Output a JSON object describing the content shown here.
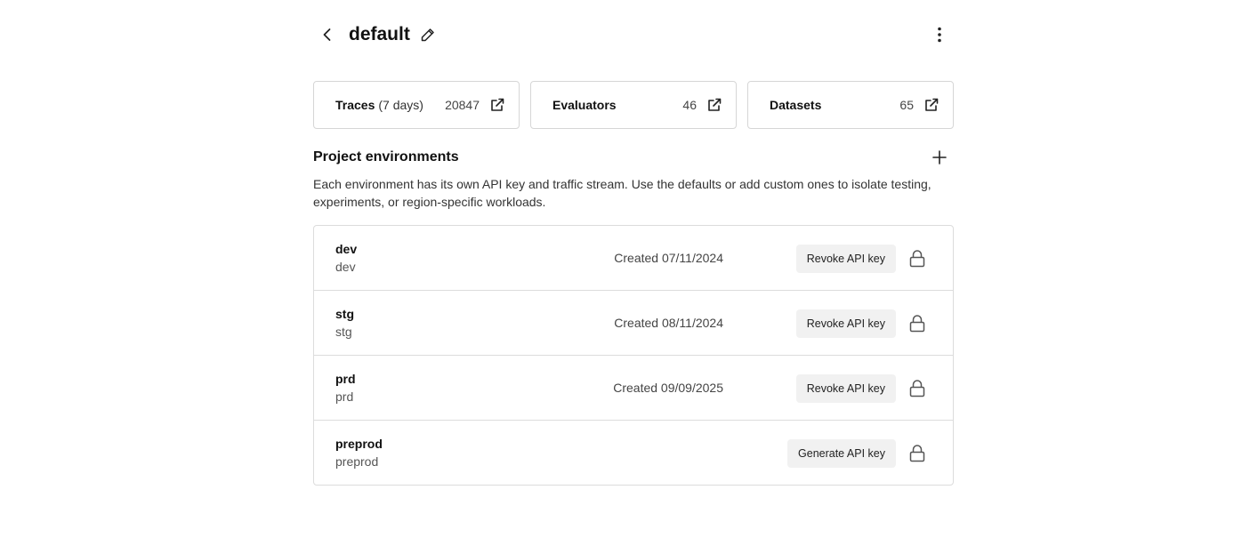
{
  "header": {
    "title": "default"
  },
  "stats": [
    {
      "label": "Traces",
      "sublabel": "(7 days)",
      "value": "20847"
    },
    {
      "label": "Evaluators",
      "sublabel": "",
      "value": "46"
    },
    {
      "label": "Datasets",
      "sublabel": "",
      "value": "65"
    }
  ],
  "environments_section": {
    "title": "Project environments",
    "description": "Each environment has its own API key and traffic stream. Use the defaults or add custom ones to isolate testing, experiments, or region-specific workloads."
  },
  "environments": [
    {
      "name": "dev",
      "slug": "dev",
      "created": "Created 07/11/2024",
      "action": "Revoke API key"
    },
    {
      "name": "stg",
      "slug": "stg",
      "created": "Created 08/11/2024",
      "action": "Revoke API key"
    },
    {
      "name": "prd",
      "slug": "prd",
      "created": "Created 09/09/2025",
      "action": "Revoke API key"
    },
    {
      "name": "preprod",
      "slug": "preprod",
      "created": "",
      "action": "Generate API key"
    }
  ],
  "icons": {
    "back": "chevron-left-icon",
    "edit": "pencil-icon",
    "more": "more-vertical-icon",
    "external": "external-link-icon",
    "add": "plus-icon",
    "lock": "lock-icon"
  }
}
